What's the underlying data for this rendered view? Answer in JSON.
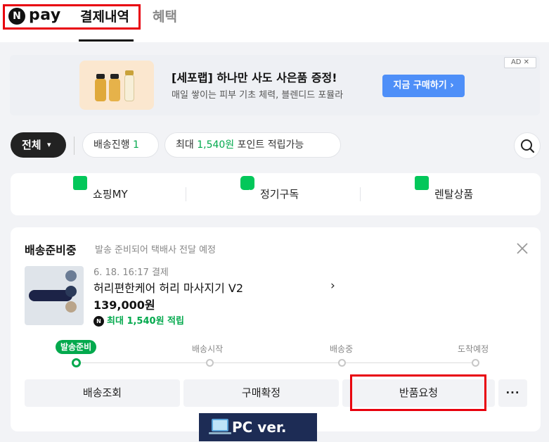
{
  "header": {
    "brand_logo_letter": "N",
    "brand_text": "pay",
    "tab_history": "결제내역",
    "tab_benefit": "혜택"
  },
  "ad": {
    "title": "[세포랩] 하나만 사도 사은품 증정!",
    "subtitle": "매일 쌓이는 피부 기초 체력, 블렌디드 포뮬라",
    "cta": "지금 구매하기 ›",
    "badge": "AD ✕"
  },
  "filters": {
    "all_label": "전체",
    "all_chevron": "▾",
    "shipping_label": "배송진행",
    "shipping_count": "1",
    "point_prefix": "최대",
    "point_amount": "1,540원",
    "point_suffix": "포인트 적립가능"
  },
  "categories": [
    {
      "label": "쇼핑MY",
      "icon": "shopping-bag-icon"
    },
    {
      "label": "정기구독",
      "icon": "refresh-icon"
    },
    {
      "label": "렌탈상품",
      "icon": "check-square-icon"
    }
  ],
  "order": {
    "status_title": "배송준비중",
    "status_desc": "발송 준비되어 택배사 전달 예정",
    "date": "6. 18. 16:17 결제",
    "product_name": "허리편한케어 허리 마사지기 V2",
    "price": "139,000원",
    "point_badge": "N",
    "point_text": "최대 1,540원 적립",
    "steps": [
      "발송준비",
      "배송시작",
      "배송중",
      "도착예정"
    ],
    "active_step": 0,
    "actions": {
      "track": "배송조회",
      "confirm": "구매확정",
      "return": "반품요청",
      "more": "···"
    }
  },
  "footer_label": "PC ver.",
  "colors": {
    "accent_green": "#03a94d",
    "highlight_red": "#e8000d",
    "cta_blue": "#4e8ff8",
    "pc_label_bg": "#1d2c55"
  }
}
